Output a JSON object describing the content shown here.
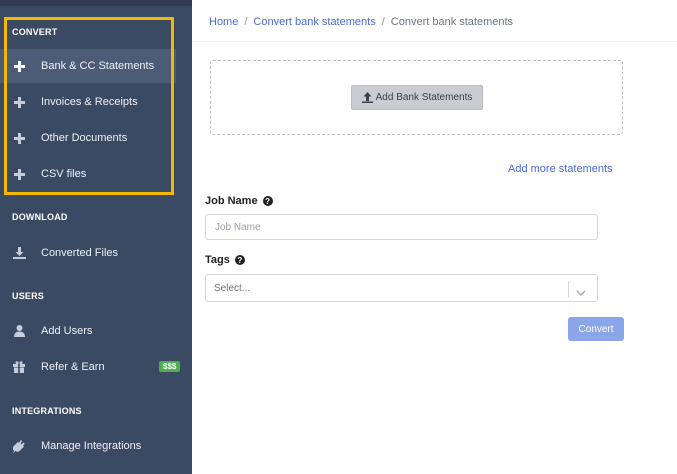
{
  "sidebar": {
    "sections": {
      "convert": "CONVERT",
      "download": "DOWNLOAD",
      "users": "USERS",
      "integrations": "INTEGRATIONS"
    },
    "items": {
      "bank": "Bank & CC Statements",
      "invoices": "Invoices & Receipts",
      "other": "Other Documents",
      "csv": "CSV files",
      "converted": "Converted Files",
      "add_users": "Add Users",
      "refer": "Refer & Earn",
      "integrations": "Manage Integrations"
    },
    "refer_badge": "$$$"
  },
  "breadcrumb": {
    "home": "Home",
    "parent": "Convert bank statements",
    "current": "Convert bank statements"
  },
  "upload": {
    "add_button": "Add Bank Statements",
    "add_more": "Add more statements"
  },
  "form": {
    "job_name_label": "Job Name",
    "job_name_placeholder": "Job Name",
    "tags_label": "Tags",
    "tags_placeholder": "Select...",
    "convert_button": "Convert"
  },
  "colors": {
    "sidebar_bg": "#3b4a63",
    "sidebar_active": "#4d5c76",
    "highlight": "#f5b800",
    "link": "#4a6bd6",
    "primary_button": "#8aa5e8",
    "badge": "#4cae4c"
  },
  "icons": {
    "plus": "plus-icon",
    "download": "download-icon",
    "user": "user-icon",
    "gift": "gift-icon",
    "plug": "plug-icon",
    "upload": "upload-icon",
    "help": "help-icon",
    "chevron": "chevron-down-icon"
  }
}
